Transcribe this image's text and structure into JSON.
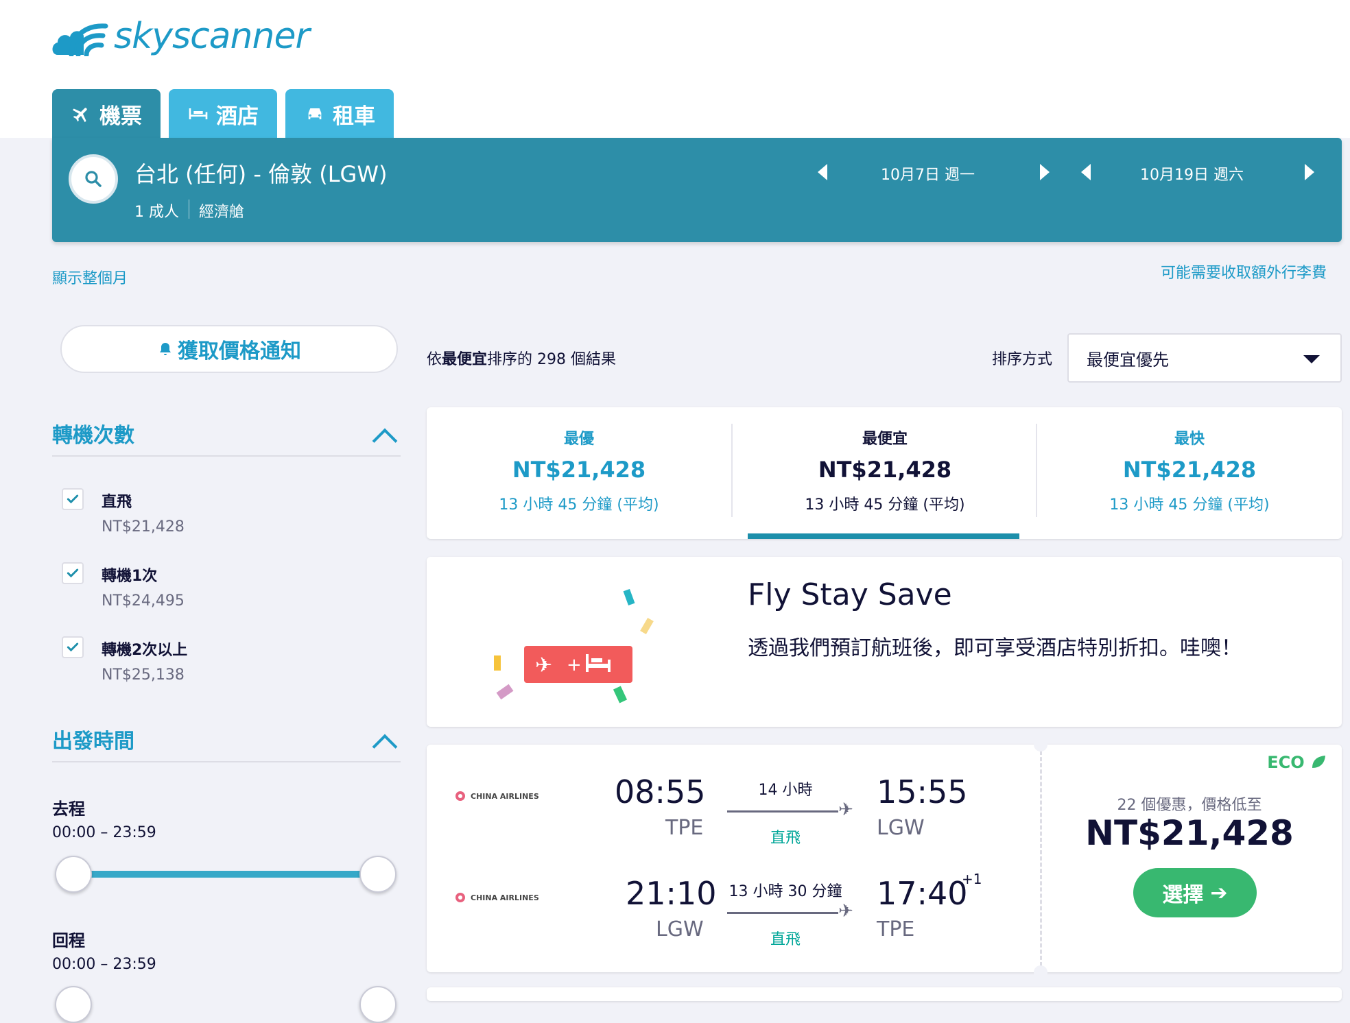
{
  "brand": {
    "name": "skyscanner"
  },
  "tabs": [
    {
      "label": "機票",
      "icon": "plane-icon"
    },
    {
      "label": "酒店",
      "icon": "bed-icon"
    },
    {
      "label": "租車",
      "icon": "car-icon"
    }
  ],
  "search": {
    "route": "台北 (任何) - 倫敦 (LGW)",
    "passengers": "1 成人",
    "cabin": "經濟艙",
    "depart_date": "10月7日 週一",
    "return_date": "10月19日 週六"
  },
  "links": {
    "show_month": "顯示整個月",
    "baggage_fee": "可能需要收取額外行李費"
  },
  "sidebar": {
    "price_alert": "獲取價格通知",
    "stops_title": "轉機次數",
    "stops": [
      {
        "label": "直飛",
        "price": "NT$21,428",
        "checked": true
      },
      {
        "label": "轉機1次",
        "price": "NT$24,495",
        "checked": true
      },
      {
        "label": "轉機2次以上",
        "price": "NT$25,138",
        "checked": true
      }
    ],
    "times_title": "出發時間",
    "outbound_label": "去程",
    "outbound_range": "00:00 – 23:59",
    "return_label": "回程",
    "return_range": "00:00 – 23:59"
  },
  "results": {
    "count_prefix": "依",
    "count_bold": "最便宜",
    "count_suffix": "排序的 298 個結果",
    "sort_label": "排序方式",
    "sort_value": "最便宜優先"
  },
  "summary": [
    {
      "title": "最優",
      "price": "NT$21,428",
      "duration": "13 小時 45 分鐘 (平均)"
    },
    {
      "title": "最便宜",
      "price": "NT$21,428",
      "duration": "13 小時 45 分鐘 (平均)"
    },
    {
      "title": "最快",
      "price": "NT$21,428",
      "duration": "13 小時 45 分鐘 (平均)"
    }
  ],
  "promo": {
    "title": "Fly Stay Save",
    "text": "透過我們預訂航班後，即可享受酒店特別折扣。哇噢！"
  },
  "flight": {
    "eco": "ECO",
    "airline": "CHINA AIRLINES",
    "outbound": {
      "dep_time": "08:55",
      "dep_code": "TPE",
      "duration": "14 小時",
      "stops": "直飛",
      "arr_time": "15:55",
      "arr_code": "LGW"
    },
    "inbound": {
      "dep_time": "21:10",
      "dep_code": "LGW",
      "duration": "13 小時 30 分鐘",
      "stops": "直飛",
      "arr_time": "17:40",
      "arr_code": "TPE",
      "day_offset": "+1"
    },
    "deals_text": "22 個優惠，價格低至",
    "price": "NT$21,428",
    "select_label": "選擇"
  },
  "colors": {
    "accent": "#1d9ac7",
    "bar": "#2d8ea8",
    "tab": "#41b8e0",
    "green": "#38b870"
  }
}
